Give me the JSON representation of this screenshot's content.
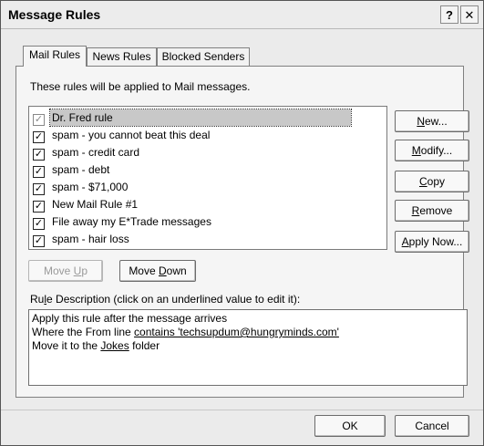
{
  "window": {
    "title": "Message Rules",
    "help_glyph": "?",
    "close_glyph": "✕"
  },
  "tabs": [
    {
      "label": "Mail Rules"
    },
    {
      "label": "News Rules"
    },
    {
      "label": "Blocked Senders"
    }
  ],
  "panel": {
    "intro": "These rules will be applied to Mail messages.",
    "rules": [
      {
        "label": "Dr. Fred rule",
        "checked": true,
        "selected": true
      },
      {
        "label": "spam - you cannot beat this deal",
        "checked": true
      },
      {
        "label": "spam - credit card",
        "checked": true
      },
      {
        "label": "spam - debt",
        "checked": true
      },
      {
        "label": "spam - $71,000",
        "checked": true
      },
      {
        "label": "New Mail Rule #1",
        "checked": true
      },
      {
        "label": "File away my E*Trade messages",
        "checked": true
      },
      {
        "label": "spam - hair loss",
        "checked": true
      }
    ],
    "side_buttons": {
      "new": {
        "key": "N",
        "rest": "ew..."
      },
      "modify": {
        "key": "M",
        "rest": "odify..."
      },
      "copy": {
        "key": "C",
        "rest": "opy"
      },
      "remove": {
        "key": "R",
        "rest": "emove"
      },
      "apply": {
        "key": "A",
        "rest": "pply Now..."
      }
    },
    "move_up": {
      "pre": "Move ",
      "key": "U",
      "rest": "p"
    },
    "move_down": {
      "pre": "Move ",
      "key": "D",
      "rest": "own"
    },
    "description_label": {
      "pre": "Ru",
      "key": "l",
      "rest": "e Description (click on an underlined value to edit it):"
    },
    "description": {
      "line1": "Apply this rule after the message arrives",
      "line2_pre": "Where the From line ",
      "line2_link": "contains 'techsupdum@hungryminds.com'",
      "line3_pre": "Move it to the ",
      "line3_link": "Jokes",
      "line3_post": " folder"
    }
  },
  "footer": {
    "ok_label": "OK",
    "cancel_label": "Cancel"
  }
}
